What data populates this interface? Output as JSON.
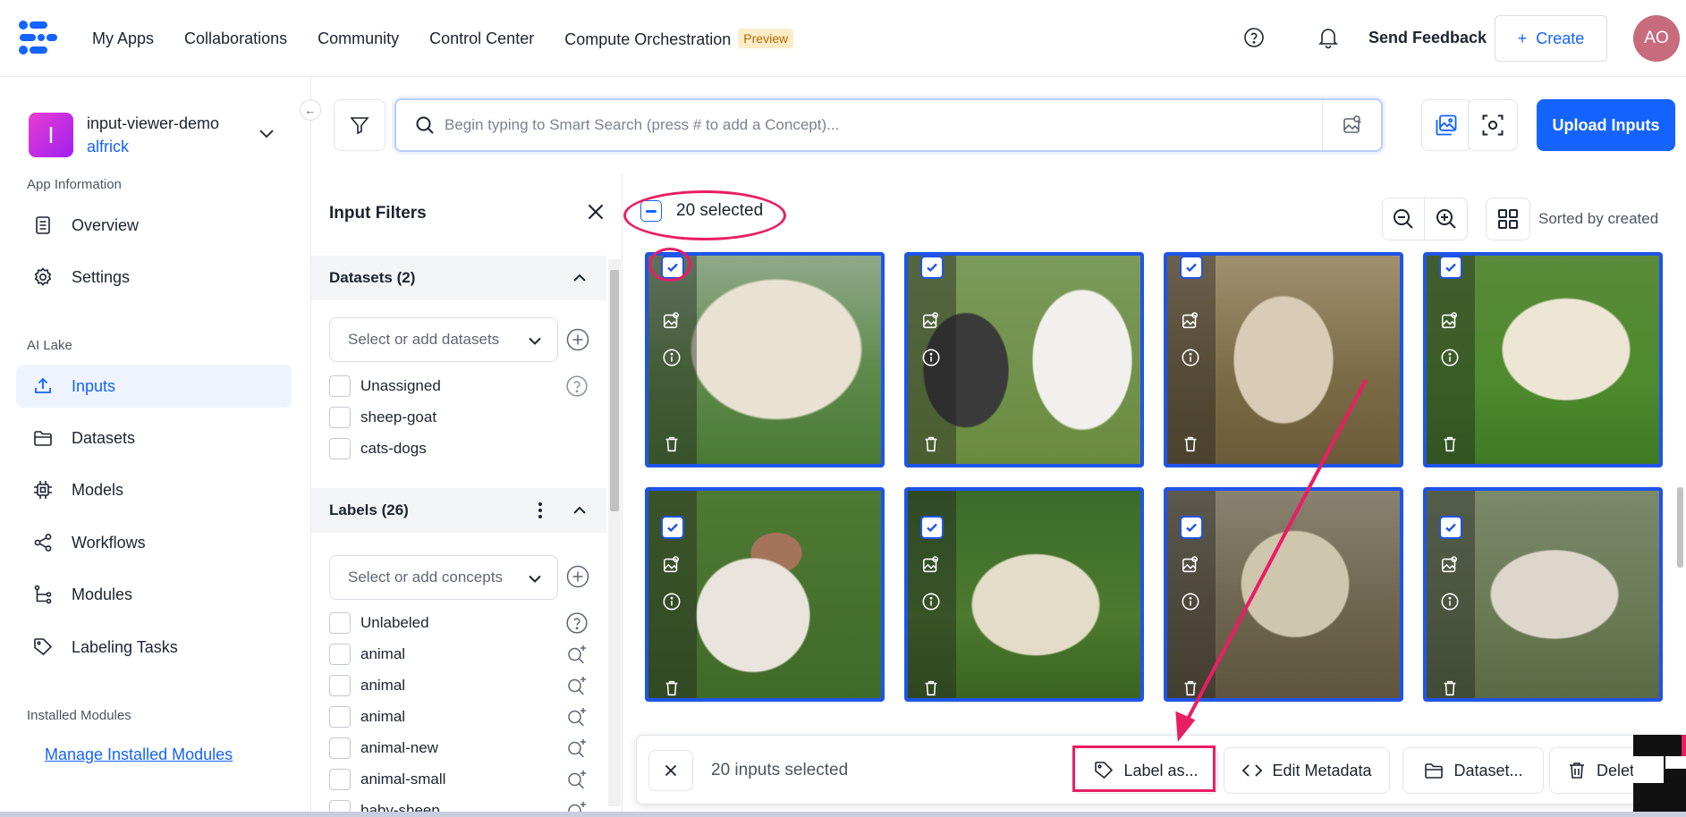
{
  "nav": {
    "links": [
      "My Apps",
      "Collaborations",
      "Community",
      "Control Center",
      "Compute Orchestration"
    ],
    "preview_badge": "Preview",
    "send_feedback": "Send Feedback",
    "create": "Create",
    "avatar": "AO"
  },
  "app": {
    "initial": "I",
    "name": "input-viewer-demo",
    "user": "alfrick"
  },
  "sidebar": {
    "app_info_heading": "App Information",
    "app_info_items": [
      {
        "label": "Overview",
        "icon": "document-icon"
      },
      {
        "label": "Settings",
        "icon": "gear-icon"
      }
    ],
    "ai_lake_heading": "AI Lake",
    "ai_lake_items": [
      {
        "label": "Inputs",
        "icon": "upload-icon",
        "active": true
      },
      {
        "label": "Datasets",
        "icon": "folder-icon"
      },
      {
        "label": "Models",
        "icon": "chip-icon"
      },
      {
        "label": "Workflows",
        "icon": "share-icon"
      },
      {
        "label": "Modules",
        "icon": "tree-icon"
      },
      {
        "label": "Labeling Tasks",
        "icon": "tag-icon"
      }
    ],
    "installed_heading": "Installed Modules",
    "manage_link": "Manage Installed Modules"
  },
  "search": {
    "placeholder": "Begin typing to Smart Search (press # to add a Concept)..."
  },
  "upload_button": "Upload Inputs",
  "filters": {
    "title": "Input Filters",
    "datasets": {
      "heading": "Datasets (2)",
      "select_placeholder": "Select or add datasets",
      "options": [
        "Unassigned",
        "sheep-goat",
        "cats-dogs"
      ]
    },
    "labels": {
      "heading": "Labels (26)",
      "select_placeholder": "Select or add concepts",
      "options": [
        "Unlabeled",
        "animal",
        "animal",
        "animal",
        "animal-new",
        "animal-small",
        "baby-sheep"
      ]
    }
  },
  "grid": {
    "selected_text": "20 selected",
    "sort_label": "Sorted by created",
    "tile_count": 8
  },
  "actionbar": {
    "count_text": "20 inputs selected",
    "buttons": [
      "Label as...",
      "Edit Metadata",
      "Dataset...",
      "Delete"
    ]
  },
  "colors": {
    "accent": "#1463ff",
    "annotation": "#e91e63",
    "tile_border": "#1f54e8"
  }
}
